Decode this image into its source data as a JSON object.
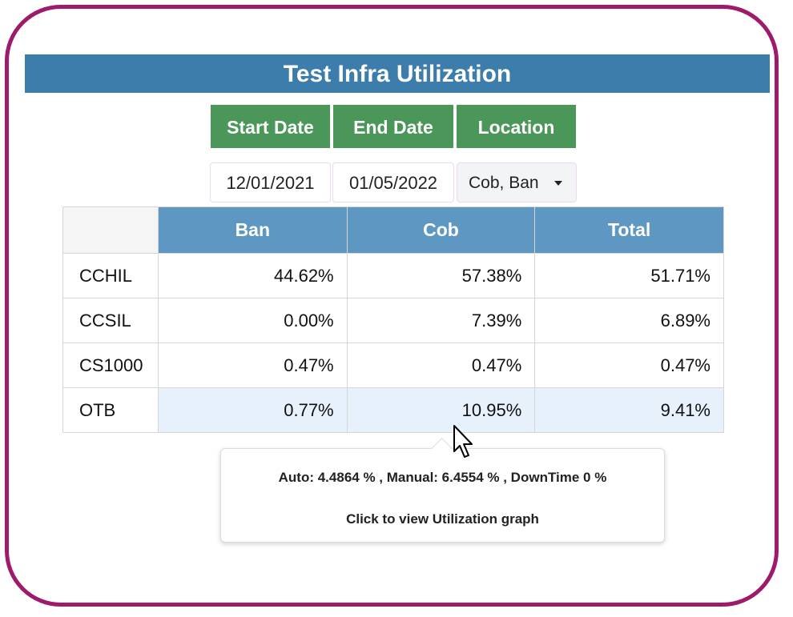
{
  "header": {
    "title": "Test Infra Utilization"
  },
  "filters": {
    "start_label": "Start Date",
    "end_label": "End Date",
    "location_label": "Location",
    "start_value": "12/01/2021",
    "end_value": "01/05/2022",
    "location_value": "Cob, Ban"
  },
  "table": {
    "columns": [
      "",
      "Ban",
      "Cob",
      "Total"
    ],
    "rows": [
      {
        "label": "CCHIL",
        "ban": "44.62%",
        "cob": "57.38%",
        "total": "51.71%"
      },
      {
        "label": "CCSIL",
        "ban": "0.00%",
        "cob": "7.39%",
        "total": "6.89%"
      },
      {
        "label": "CS1000",
        "ban": "0.47%",
        "cob": "0.47%",
        "total": "0.47%"
      },
      {
        "label": "OTB",
        "ban": "0.77%",
        "cob": "10.95%",
        "total": "9.41%"
      }
    ]
  },
  "tooltip": {
    "details": "Auto: 4.4864 % , Manual: 6.4554 % , DownTime 0 %",
    "action": "Click to view Utilization graph"
  },
  "colors": {
    "frame": "#9e1a6a",
    "title_bg": "#3c7dab",
    "button_bg": "#4b975a",
    "table_header_bg": "#5f97c3",
    "row_highlight": "#e6f1fb"
  }
}
